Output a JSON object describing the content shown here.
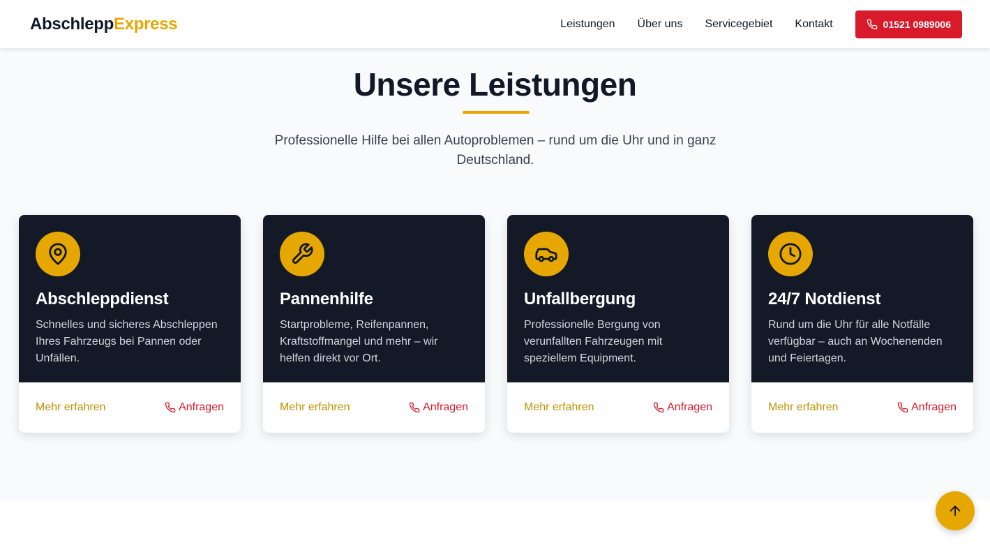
{
  "header": {
    "logo_main": "Abschlepp",
    "logo_accent": "Express",
    "nav": [
      "Leistungen",
      "Über uns",
      "Servicegebiet",
      "Kontakt"
    ],
    "phone_button": "01521 0989006"
  },
  "services": {
    "title": "Unsere Leistungen",
    "subtitle": "Professionelle Hilfe bei allen Autoproblemen – rund um die Uhr und in ganz Deutschland.",
    "cards": [
      {
        "icon": "map-pin-icon",
        "title": "Abschleppdienst",
        "text": "Schnelles und sicheres Abschleppen Ihres Fahrzeugs bei Pannen oder Unfällen.",
        "more_label": "Mehr erfahren",
        "request_label": "Anfragen"
      },
      {
        "icon": "wrench-icon",
        "title": "Pannenhilfe",
        "text": "Startprobleme, Reifenpannen, Kraftstoffmangel und mehr – wir helfen direkt vor Ort.",
        "more_label": "Mehr erfahren",
        "request_label": "Anfragen"
      },
      {
        "icon": "car-icon",
        "title": "Unfallbergung",
        "text": "Professionelle Bergung von verunfallten Fahrzeugen mit speziellem Equipment.",
        "more_label": "Mehr erfahren",
        "request_label": "Anfragen"
      },
      {
        "icon": "clock-icon",
        "title": "24/7 Notdienst",
        "text": "Rund um die Uhr für alle Notfälle verfügbar – auch an Wochenenden und Feiertagen.",
        "more_label": "Mehr erfahren",
        "request_label": "Anfragen"
      }
    ]
  },
  "scroll_top_icon": "arrow-up-icon",
  "colors": {
    "accent_yellow": "#e6a800",
    "accent_red": "#d81a2a",
    "card_dark": "#131927",
    "text_dark": "#111827"
  }
}
